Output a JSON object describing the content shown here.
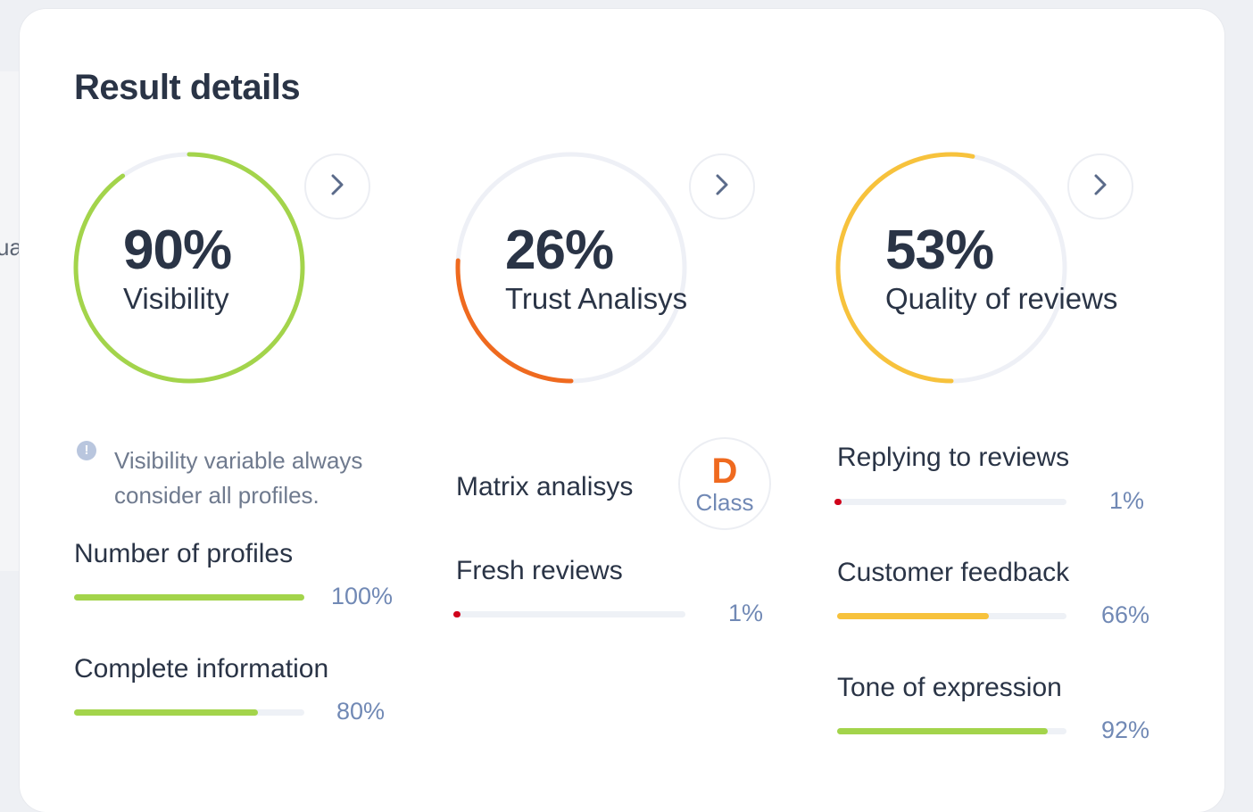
{
  "background": {
    "partial_text": "ua"
  },
  "card": {
    "title": "Result details"
  },
  "gauges": [
    {
      "value_text": "90%",
      "label": "Visibility",
      "percent": 90,
      "color": "#a3d44b"
    },
    {
      "value_text": "26%",
      "label": "Trust Analisys",
      "percent": 26,
      "color": "#ef6a1f"
    },
    {
      "value_text": "53%",
      "label": "Quality of reviews",
      "percent": 53,
      "color": "#f7c23c"
    }
  ],
  "visibility": {
    "info_text_line1": "Visibility variable always",
    "info_text_line2": "consider all profiles.",
    "metrics": [
      {
        "label": "Number of profiles",
        "value_text": "100%",
        "percent": 100,
        "color": "#a3d44b"
      },
      {
        "label": "Complete information",
        "value_text": "80%",
        "percent": 80,
        "color": "#a3d44b"
      }
    ]
  },
  "trust": {
    "matrix_label": "Matrix analisys",
    "class_letter": "D",
    "class_word": "Class",
    "metrics": [
      {
        "label": "Fresh reviews",
        "value_text": "1%",
        "percent": 1,
        "color": "#d0021b"
      }
    ]
  },
  "quality": {
    "metrics": [
      {
        "label": "Replying to reviews",
        "value_text": "1%",
        "percent": 1,
        "color": "#d0021b"
      },
      {
        "label": "Customer feedback",
        "value_text": "66%",
        "percent": 66,
        "color": "#f7c23c"
      },
      {
        "label": "Tone of expression",
        "value_text": "92%",
        "percent": 92,
        "color": "#a3d44b"
      }
    ]
  }
}
